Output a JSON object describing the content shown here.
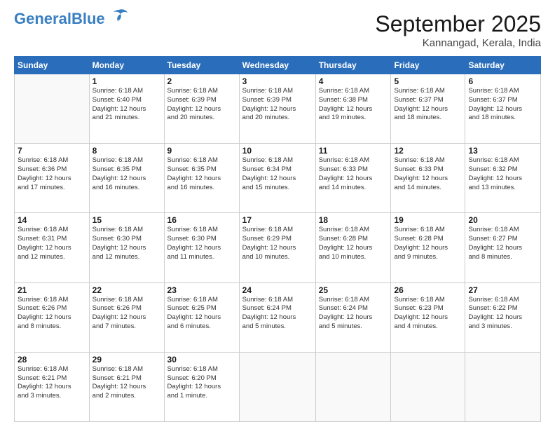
{
  "header": {
    "logo_line1": "General",
    "logo_line2": "Blue",
    "month": "September 2025",
    "location": "Kannangad, Kerala, India"
  },
  "weekdays": [
    "Sunday",
    "Monday",
    "Tuesday",
    "Wednesday",
    "Thursday",
    "Friday",
    "Saturday"
  ],
  "weeks": [
    [
      {
        "num": "",
        "info": ""
      },
      {
        "num": "1",
        "info": "Sunrise: 6:18 AM\nSunset: 6:40 PM\nDaylight: 12 hours\nand 21 minutes."
      },
      {
        "num": "2",
        "info": "Sunrise: 6:18 AM\nSunset: 6:39 PM\nDaylight: 12 hours\nand 20 minutes."
      },
      {
        "num": "3",
        "info": "Sunrise: 6:18 AM\nSunset: 6:39 PM\nDaylight: 12 hours\nand 20 minutes."
      },
      {
        "num": "4",
        "info": "Sunrise: 6:18 AM\nSunset: 6:38 PM\nDaylight: 12 hours\nand 19 minutes."
      },
      {
        "num": "5",
        "info": "Sunrise: 6:18 AM\nSunset: 6:37 PM\nDaylight: 12 hours\nand 18 minutes."
      },
      {
        "num": "6",
        "info": "Sunrise: 6:18 AM\nSunset: 6:37 PM\nDaylight: 12 hours\nand 18 minutes."
      }
    ],
    [
      {
        "num": "7",
        "info": "Sunrise: 6:18 AM\nSunset: 6:36 PM\nDaylight: 12 hours\nand 17 minutes."
      },
      {
        "num": "8",
        "info": "Sunrise: 6:18 AM\nSunset: 6:35 PM\nDaylight: 12 hours\nand 16 minutes."
      },
      {
        "num": "9",
        "info": "Sunrise: 6:18 AM\nSunset: 6:35 PM\nDaylight: 12 hours\nand 16 minutes."
      },
      {
        "num": "10",
        "info": "Sunrise: 6:18 AM\nSunset: 6:34 PM\nDaylight: 12 hours\nand 15 minutes."
      },
      {
        "num": "11",
        "info": "Sunrise: 6:18 AM\nSunset: 6:33 PM\nDaylight: 12 hours\nand 14 minutes."
      },
      {
        "num": "12",
        "info": "Sunrise: 6:18 AM\nSunset: 6:33 PM\nDaylight: 12 hours\nand 14 minutes."
      },
      {
        "num": "13",
        "info": "Sunrise: 6:18 AM\nSunset: 6:32 PM\nDaylight: 12 hours\nand 13 minutes."
      }
    ],
    [
      {
        "num": "14",
        "info": "Sunrise: 6:18 AM\nSunset: 6:31 PM\nDaylight: 12 hours\nand 12 minutes."
      },
      {
        "num": "15",
        "info": "Sunrise: 6:18 AM\nSunset: 6:30 PM\nDaylight: 12 hours\nand 12 minutes."
      },
      {
        "num": "16",
        "info": "Sunrise: 6:18 AM\nSunset: 6:30 PM\nDaylight: 12 hours\nand 11 minutes."
      },
      {
        "num": "17",
        "info": "Sunrise: 6:18 AM\nSunset: 6:29 PM\nDaylight: 12 hours\nand 10 minutes."
      },
      {
        "num": "18",
        "info": "Sunrise: 6:18 AM\nSunset: 6:28 PM\nDaylight: 12 hours\nand 10 minutes."
      },
      {
        "num": "19",
        "info": "Sunrise: 6:18 AM\nSunset: 6:28 PM\nDaylight: 12 hours\nand 9 minutes."
      },
      {
        "num": "20",
        "info": "Sunrise: 6:18 AM\nSunset: 6:27 PM\nDaylight: 12 hours\nand 8 minutes."
      }
    ],
    [
      {
        "num": "21",
        "info": "Sunrise: 6:18 AM\nSunset: 6:26 PM\nDaylight: 12 hours\nand 8 minutes."
      },
      {
        "num": "22",
        "info": "Sunrise: 6:18 AM\nSunset: 6:26 PM\nDaylight: 12 hours\nand 7 minutes."
      },
      {
        "num": "23",
        "info": "Sunrise: 6:18 AM\nSunset: 6:25 PM\nDaylight: 12 hours\nand 6 minutes."
      },
      {
        "num": "24",
        "info": "Sunrise: 6:18 AM\nSunset: 6:24 PM\nDaylight: 12 hours\nand 5 minutes."
      },
      {
        "num": "25",
        "info": "Sunrise: 6:18 AM\nSunset: 6:24 PM\nDaylight: 12 hours\nand 5 minutes."
      },
      {
        "num": "26",
        "info": "Sunrise: 6:18 AM\nSunset: 6:23 PM\nDaylight: 12 hours\nand 4 minutes."
      },
      {
        "num": "27",
        "info": "Sunrise: 6:18 AM\nSunset: 6:22 PM\nDaylight: 12 hours\nand 3 minutes."
      }
    ],
    [
      {
        "num": "28",
        "info": "Sunrise: 6:18 AM\nSunset: 6:21 PM\nDaylight: 12 hours\nand 3 minutes."
      },
      {
        "num": "29",
        "info": "Sunrise: 6:18 AM\nSunset: 6:21 PM\nDaylight: 12 hours\nand 2 minutes."
      },
      {
        "num": "30",
        "info": "Sunrise: 6:18 AM\nSunset: 6:20 PM\nDaylight: 12 hours\nand 1 minute."
      },
      {
        "num": "",
        "info": ""
      },
      {
        "num": "",
        "info": ""
      },
      {
        "num": "",
        "info": ""
      },
      {
        "num": "",
        "info": ""
      }
    ]
  ]
}
